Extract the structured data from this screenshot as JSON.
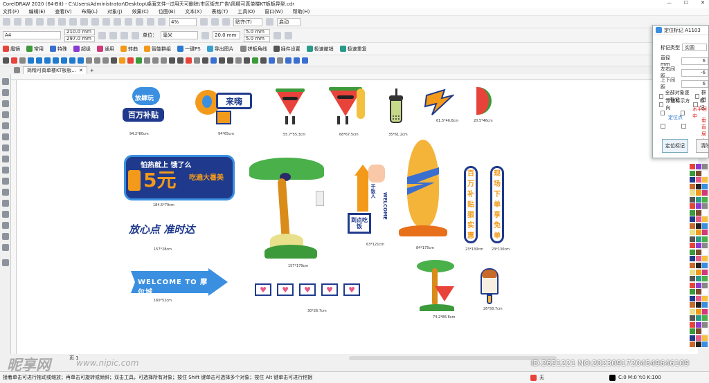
{
  "titlebar": {
    "title": "CorelDRAW 2020 (64-Bit) - C:\\Users\\Administrator\\Desktop\\桌面文件--过用天可删除\\市区街东广告\\简精可真单楼KT板板异型.cdr",
    "min": "—",
    "max": "☐",
    "close": "✕"
  },
  "menu": [
    "文件(F)",
    "编辑(E)",
    "查看(V)",
    "布局(L)",
    "对象(J)",
    "效果(C)",
    "位图(B)",
    "文本(X)",
    "表格(T)",
    "工具(O)",
    "窗口(W)",
    "帮助(H)"
  ],
  "toolbar": {
    "zoom": "4%",
    "snap": "贴齐(T)",
    "launch": "启动"
  },
  "props": {
    "page_size": "A4",
    "width": "210.0 mm",
    "height": "297.0 mm",
    "units_label": "单位：",
    "units": "毫米",
    "nudge": "20.0 mm",
    "dup_x": "5.0 mm",
    "dup_y": "5.0 mm"
  },
  "plugin_bar": [
    "魔镜",
    "常用",
    "特殊",
    "超级",
    "通用",
    "转曲",
    "智能群组",
    "一键PS",
    "导出图片",
    "拼板角线",
    "插件设置",
    "极速撤销",
    "极速重复"
  ],
  "doc_tab": "简精可真单楼KT板板...",
  "dialog": {
    "title": "定位标记 A1103",
    "type_label": "标记类型",
    "type_value": "实圆",
    "diameter_label": "直径mm",
    "diameter_value": "6",
    "lr_label": "左右间距",
    "lr_value": "-6",
    "tb_label": "上下间距",
    "tb_value": "6",
    "opt1": "全部对象逐一标记",
    "opt1b": "群组",
    "opt2": "添加标示方向",
    "opt2b": "标记",
    "h_center": "水平居中",
    "pos_point": "定位点",
    "v_center": "垂直居中",
    "btn_mark": "定位标记",
    "btn_clear": "清除"
  },
  "canvas": {
    "art1_top": "放肆玩",
    "art1_main": "百万补贴",
    "art1_cap": "94.2*80cm",
    "art2_main": "来嗨",
    "art2_cap": "94*65cm",
    "art3_cap": "55.7*55.3cm",
    "art4_cap": "68*67.5cm",
    "art5_cap": "35*61.2cm",
    "art6_cap": "61.5*46.8cm",
    "art7_cap": "20.5*46cm",
    "art8_line1": "怕热就上 饿了么",
    "art8_big": "5元",
    "art8_side": "吃遍大暑美",
    "art8_cap": "184.5*79cm",
    "art9_text": "放心点 准时达",
    "art9_cap": "157*28cm",
    "art10_cap": "157*179cm",
    "art11_text1": "干饭人",
    "art11_text2": "到点吃饭",
    "art11_text3": "WELCOME",
    "art11_cap": "63*121cm",
    "art12_cap": "84*175cm",
    "art13_text": "百万补贴狠实惠",
    "art13_cap": "23*130cm",
    "art14_text": "现场下单享免单",
    "art14_cap": "23*130cm",
    "art15_text": "WELCOME TO 摩尔城",
    "art15_cap": "160*52cm",
    "art16_cap": "30*26.7cm",
    "art17_cap": "74.2*86.6cm",
    "art18_cap": "26*58.7cm"
  },
  "page_nav": "页 1",
  "status": {
    "hint": "接着单击可进行拖动或缩放；再单击可旋转或倾斜；双击工具，可选择所有对象；按住 Shift 键单击可选择多个对象；按住 Alt 键单击可进行挖掘",
    "fill": "无",
    "color": "C:0 M:0 Y:0 K:100"
  },
  "watermark": {
    "brand": "昵享网",
    "url": "www.nipic.com",
    "id": "ID:2621221 NO:20230917204549646109"
  },
  "colors": {
    "navy": "#1f3a8c",
    "orange": "#f39a1a",
    "green": "#3c9a3a",
    "watermelon": "#e8433a"
  }
}
